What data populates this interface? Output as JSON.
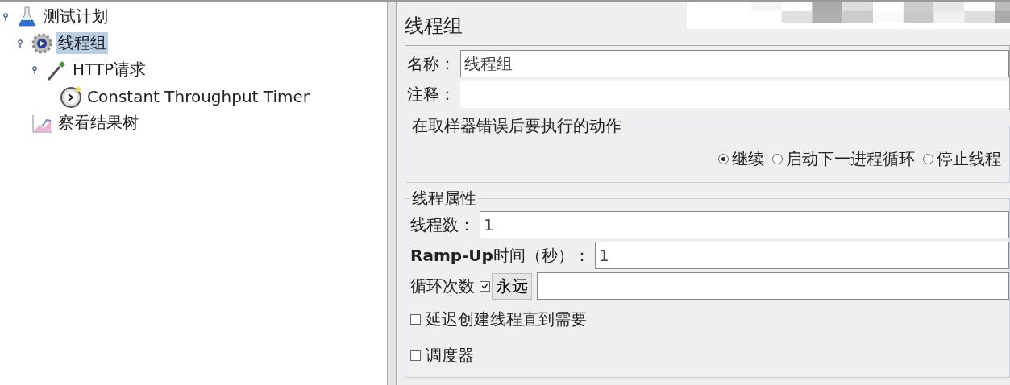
{
  "tree": [
    {
      "label": "测试计划",
      "kind": "plan",
      "selected": false,
      "children": [
        {
          "label": "线程组",
          "kind": "threadgroup",
          "selected": true,
          "children": [
            {
              "label": "HTTP请求",
              "kind": "sampler",
              "selected": false,
              "children": [
                {
                  "label": "Constant Throughput Timer",
                  "kind": "timer",
                  "selected": false
                }
              ]
            }
          ]
        },
        {
          "label": "察看结果树",
          "kind": "listener",
          "selected": false
        }
      ]
    }
  ],
  "panel": {
    "title": "线程组",
    "name_label": "名称：",
    "name_value": "线程组",
    "comment_label": "注释：",
    "error_action": {
      "legend": "在取样器错误后要执行的动作",
      "options": [
        {
          "label": "继续",
          "selected": true
        },
        {
          "label": "启动下一进程循环",
          "selected": false
        },
        {
          "label": "停止线程",
          "selected": false
        }
      ]
    },
    "thread_props": {
      "legend": "线程属性",
      "threads_label": "线程数：",
      "threads_value": "1",
      "rampup_label": "**Ramp-Up**时间（秒）：",
      "rampup_value": "1",
      "loop_label": "循环次数",
      "forever_label": "永远",
      "forever_checked": true,
      "delay_label": "延迟创建线程直到需要",
      "delay_checked": false,
      "scheduler_label": "调度器",
      "scheduler_checked": false
    }
  }
}
